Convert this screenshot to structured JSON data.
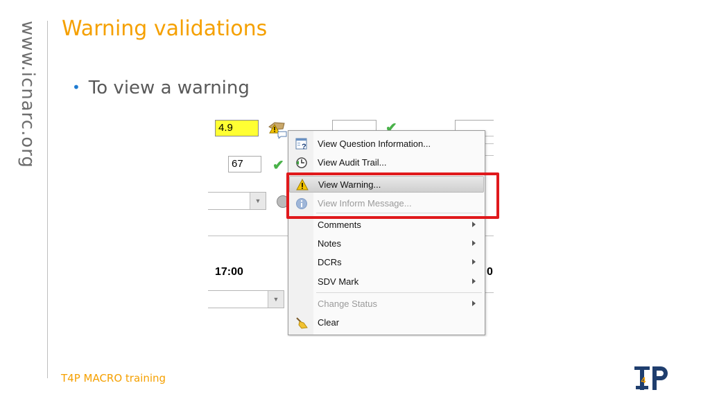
{
  "sidebar": {
    "url": "www.icnarc.org"
  },
  "slide": {
    "title": "Warning validations",
    "bullet": "To view a warning",
    "footer": "T4P MACRO training",
    "logo_alt": "T4P"
  },
  "screenshot": {
    "field_warning_value": "4.9",
    "field_second_value": "67",
    "time_left": "17:00",
    "time_right_partial": "0"
  },
  "context_menu": {
    "items": [
      {
        "label": "View Question Information...",
        "icon": "question-info-icon",
        "enabled": true
      },
      {
        "label": "View Audit Trail...",
        "icon": "audit-trail-icon",
        "enabled": true
      },
      {
        "label": "View Warning...",
        "icon": "warning-icon",
        "enabled": true,
        "highlighted": true
      },
      {
        "label": "View Inform Message...",
        "icon": "info-icon",
        "enabled": false
      },
      {
        "label": "Comments",
        "submenu": true,
        "enabled": true
      },
      {
        "label": "Notes",
        "submenu": true,
        "enabled": true
      },
      {
        "label": "DCRs",
        "submenu": true,
        "enabled": true
      },
      {
        "label": "SDV Mark",
        "submenu": true,
        "enabled": true
      },
      {
        "label": "Change Status",
        "submenu": true,
        "enabled": false
      },
      {
        "label": "Clear",
        "icon": "broom-icon",
        "enabled": true
      }
    ]
  },
  "colors": {
    "accent_orange": "#f5a000",
    "bullet_blue": "#1f7bd1",
    "highlight_red": "#e0191c",
    "warning_field_yellow": "#ffff33"
  }
}
